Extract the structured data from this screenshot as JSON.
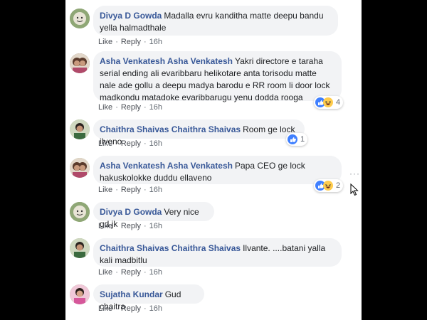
{
  "comments": [
    {
      "author": "Divya D Gowda",
      "text": "Madalla evru kanditha matte deepu bandu yella halmadthale",
      "like": "Like",
      "reply": "Reply",
      "time": "16h",
      "reactions": null
    },
    {
      "author": "Asha Venkatesh Asha Venkatesh",
      "text": "Yakri directore e taraha serial ending ali evaribbaru helikotare anta torisodu matte nale ade gollu a deepu madya barodu e RR room li door lock madkondu matadoke evaribbarugu yenu dodda rooga",
      "like": "Like",
      "reply": "Reply",
      "time": "16h",
      "reactions": "4"
    },
    {
      "author": "Chaithra Shaivas Chaithra Shaivas",
      "text": "Room ge lock ilveno",
      "like": "Like",
      "reply": "Reply",
      "time": "16h",
      "reactions": "1"
    },
    {
      "author": "Asha Venkatesh Asha Venkatesh",
      "text": "Papa CEO ge lock hakuskolokke duddu ellaveno",
      "like": "Like",
      "reply": "Reply",
      "time": "16h",
      "reactions": "2"
    },
    {
      "author": "Divya D Gowda",
      "text": "Very nice gd jk",
      "like": "Like",
      "reply": "Reply",
      "time": "16h",
      "reactions": null
    },
    {
      "author": "Chaithra Shaivas Chaithra Shaivas",
      "text": "Ilvante. ....batani yalla kali madbitlu",
      "like": "Like",
      "reply": "Reply",
      "time": "16h",
      "reactions": null
    },
    {
      "author": "Sujatha Kundar",
      "text": "Gud chaitra",
      "like": "Like",
      "reply": "Reply",
      "time": "16h",
      "reactions": null
    }
  ],
  "menu": {
    "more": "···"
  },
  "icons": {
    "like": "thumbs-up-icon",
    "haha": "laughing-face-icon",
    "more": "more-dots-icon",
    "cursor": "mouse-cursor-icon"
  },
  "colors": {
    "author": "#385898",
    "bubble": "#f2f3f5",
    "like_reaction": "#4080ff",
    "haha_reaction": "#ffcc4d"
  }
}
